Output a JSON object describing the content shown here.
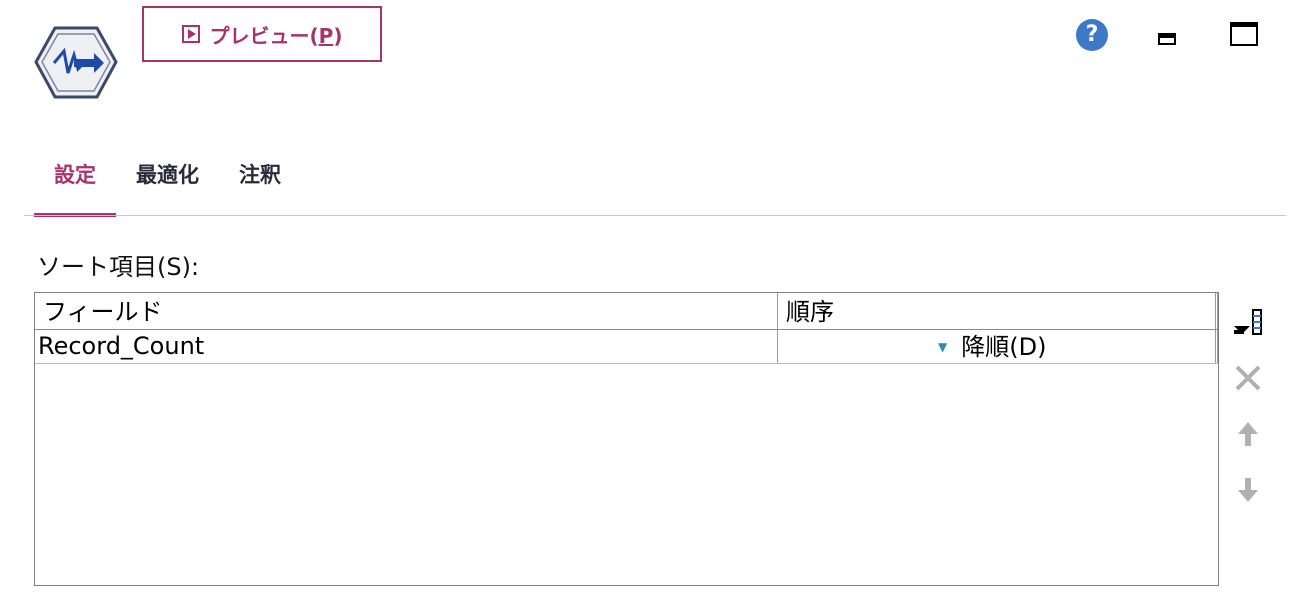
{
  "header": {
    "preview_label": "プレビュー(",
    "preview_mnemonic": "P",
    "preview_label_end": ")"
  },
  "icons": {
    "node": "sort-node-icon",
    "help": "help-icon",
    "minimize": "minimize-icon",
    "maximize": "maximize-icon",
    "help_glyph": "?"
  },
  "tabs": [
    {
      "label": "設定",
      "active": true
    },
    {
      "label": "最適化",
      "active": false
    },
    {
      "label": "注釈",
      "active": false
    }
  ],
  "sort": {
    "label": "ソート項目(S):",
    "columns": {
      "field": "フィールド",
      "order": "順序"
    },
    "rows": [
      {
        "field": "Record_Count",
        "order": "降順(D)"
      }
    ]
  },
  "colors": {
    "accent": "#a8326e",
    "help": "#3d78c9",
    "node_blue": "#1e4aa8"
  }
}
